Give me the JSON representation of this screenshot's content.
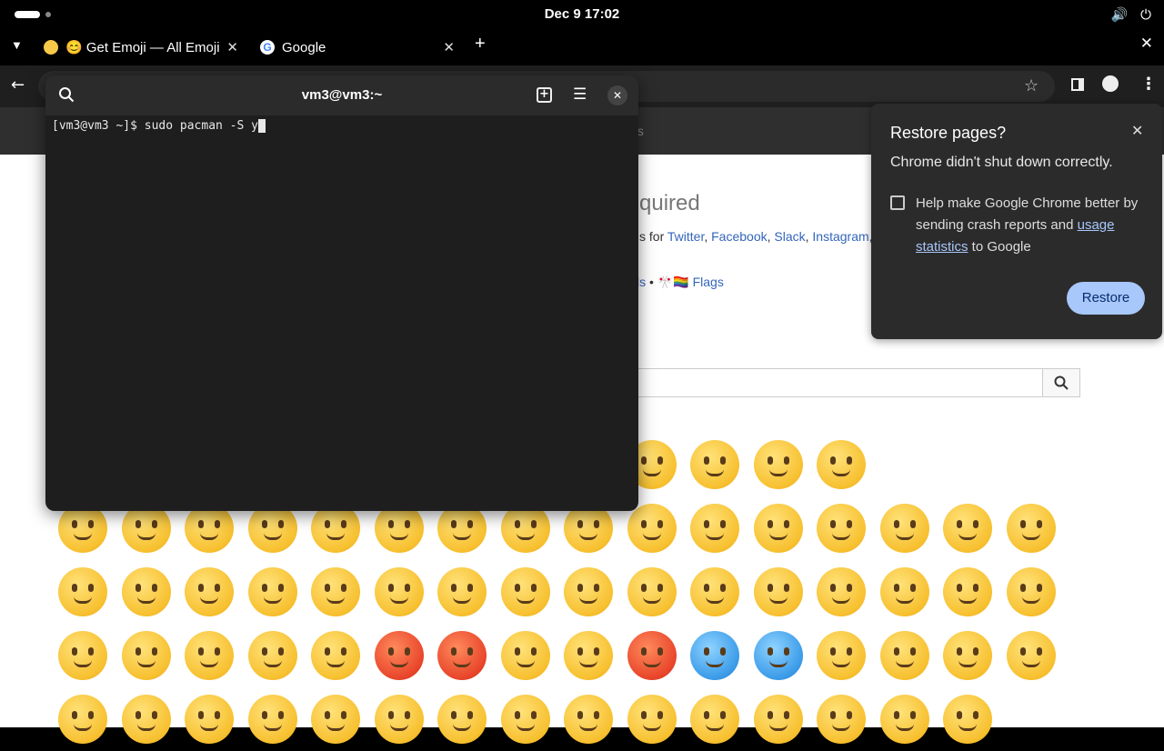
{
  "system": {
    "clock": "Dec 9  17:02",
    "volume_icon": "volume-icon",
    "power_icon": "power-icon"
  },
  "browser": {
    "tabs": [
      {
        "label": "😊 Get Emoji — All Emoji",
        "icon": "emoji-favicon"
      },
      {
        "label": "Google",
        "icon": "google-favicon"
      }
    ],
    "tab_close_glyph": "✕",
    "new_tab_glyph": "+",
    "window_close_glyph": "✕"
  },
  "webpage": {
    "nav_fragment": "ols",
    "heading_fragment": "quired",
    "copy_prefix": "s for ",
    "platforms": [
      "Twitter",
      "Facebook",
      "Slack",
      "Instagram"
    ],
    "categories_fragment": "ls",
    "categories_sep": " • ",
    "flags_emoji": "🎌🏳️‍🌈",
    "flags_label": "Flags",
    "search_icon": "search-icon"
  },
  "terminal": {
    "title": "vm3@vm3:~",
    "prompt": "[vm3@vm3 ~]$ ",
    "command": "sudo pacman -S y",
    "icons": [
      "search-icon",
      "new-tab-icon",
      "hamburger-menu-icon",
      "close-icon"
    ]
  },
  "restore_dialog": {
    "title": "Restore pages?",
    "message": "Chrome didn't shut down correctly.",
    "help_text_prefix": "Help make Google Chrome better by sending crash reports and ",
    "help_link": "usage statistics",
    "help_text_suffix": " to Google",
    "button_label": "Restore",
    "checked": false
  },
  "emoji_grid": {
    "rows": [
      [
        "",
        "",
        "",
        "",
        "",
        "",
        "🥲",
        "☺️",
        "😊",
        "😇",
        "🙂",
        "🙃",
        "😉"
      ],
      [
        "😌",
        "😍",
        "🥰",
        "😘",
        "😗",
        "😙",
        "😚",
        "😋",
        "😛",
        "😝",
        "😜",
        "🤪",
        "🤨",
        "🧐",
        "🤓",
        "😎"
      ],
      [
        "🥸",
        "🤩",
        "🥳",
        "😏",
        "😒",
        "😞",
        "😔",
        "😟",
        "😕",
        "🙁",
        "☹️",
        "😣",
        "😖",
        "😫",
        "😩",
        "🥺"
      ],
      [
        "😢",
        "😭",
        "😮‍💨",
        "😤",
        "😠",
        "😡",
        "🤬",
        "🤯",
        "😳",
        "🥵",
        "🥶",
        "😱",
        "😨",
        "😰",
        "😥",
        "😓"
      ],
      [
        "🫣",
        "🤗",
        "🫡",
        "🤔",
        "🫢",
        "🤭",
        "🤫",
        "🤥",
        "😶",
        "😶‍🌫️",
        "😐",
        "😑",
        "😬",
        "🫠",
        "🙄"
      ]
    ]
  }
}
